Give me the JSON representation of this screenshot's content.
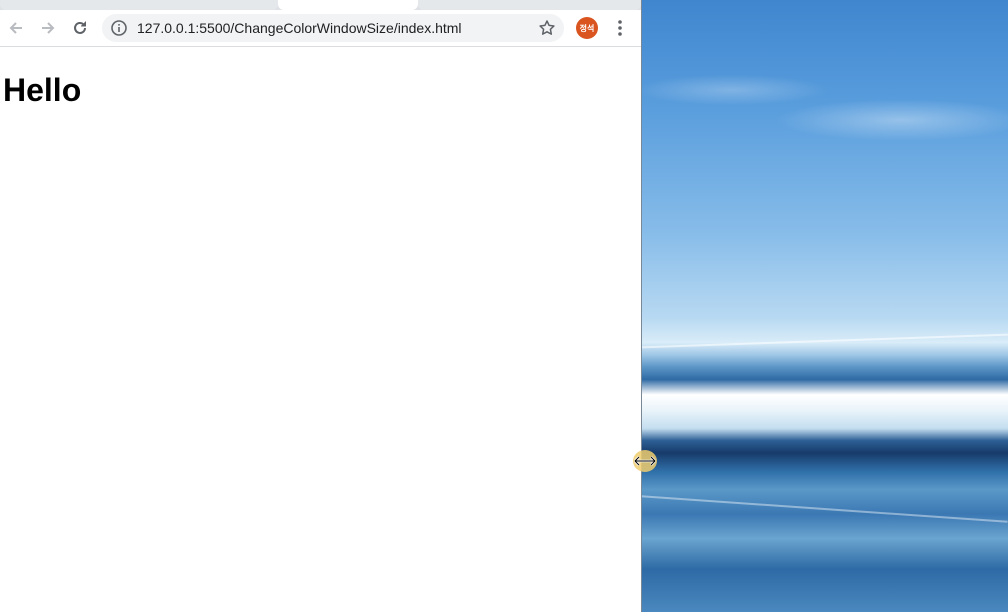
{
  "browser": {
    "url": "127.0.0.1:5500/ChangeColorWindowSize/index.html",
    "profile_initials": "정석",
    "icons": {
      "back": "arrow-left-icon",
      "forward": "arrow-right-icon",
      "reload": "reload-icon",
      "site_info": "info-circle-icon",
      "bookmark": "star-outline-icon",
      "menu": "kebab-menu-icon"
    },
    "colors": {
      "avatar": "#d9541f",
      "omnibox": "#f1f3f4"
    }
  },
  "page": {
    "heading": "Hello"
  },
  "desktop": {
    "cursor": "horizontal-resize-cursor-icon"
  }
}
